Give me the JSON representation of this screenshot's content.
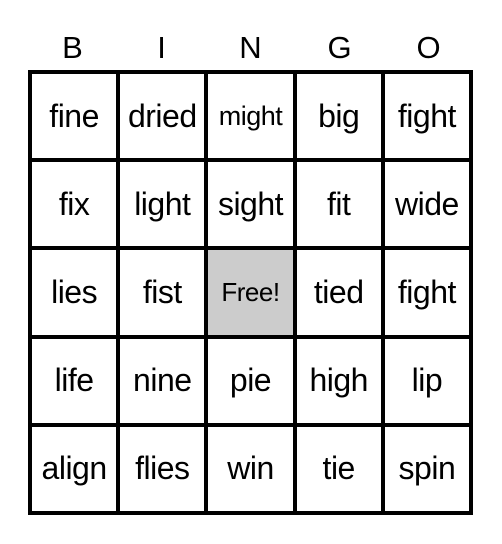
{
  "header": {
    "letters": [
      "B",
      "I",
      "N",
      "G",
      "O"
    ]
  },
  "colors": {
    "free_cell": "#cccccc",
    "grid_line": "#000000"
  },
  "board": {
    "rows": [
      [
        "fine",
        "dried",
        "might",
        "big",
        "fight"
      ],
      [
        "fix",
        "light",
        "sight",
        "fit",
        "wide"
      ],
      [
        "lies",
        "fist",
        "Free!",
        "tied",
        "fight"
      ],
      [
        "life",
        "nine",
        "pie",
        "high",
        "lip"
      ],
      [
        "align",
        "flies",
        "win",
        "tie",
        "spin"
      ]
    ],
    "free_cell": {
      "row": 2,
      "col": 2
    }
  }
}
